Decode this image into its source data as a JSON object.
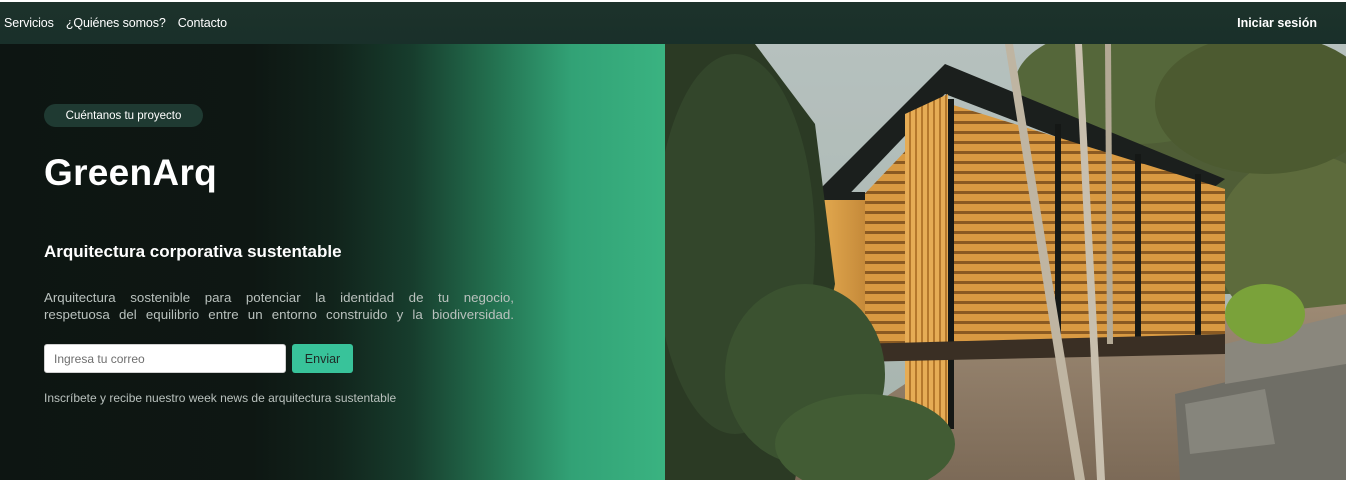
{
  "navbar": {
    "links": [
      "Servicios",
      "¿Quiénes somos?",
      "Contacto"
    ],
    "login_label": "Iniciar sesión"
  },
  "hero": {
    "pill_label": "Cuéntanos tu proyecto",
    "brand": "GreenArq",
    "subtitle": "Arquitectura corporativa sustentable",
    "description_lines": [
      "Arquitectura sostenible para potenciar la identidad de tu negocio,",
      "respetuosa del equilibrio entre un entorno construido y la biodiversidad."
    ],
    "email_placeholder": "Ingresa tu correo",
    "send_label": "Enviar",
    "signup_note": "Inscríbete y recibe nuestro week news de arquitectura sustentable"
  },
  "colors": {
    "navbar_bg": "#1d322b",
    "pill_bg": "#1f3a32",
    "accent": "#38c39a",
    "gradient_end": "#3ab381"
  }
}
